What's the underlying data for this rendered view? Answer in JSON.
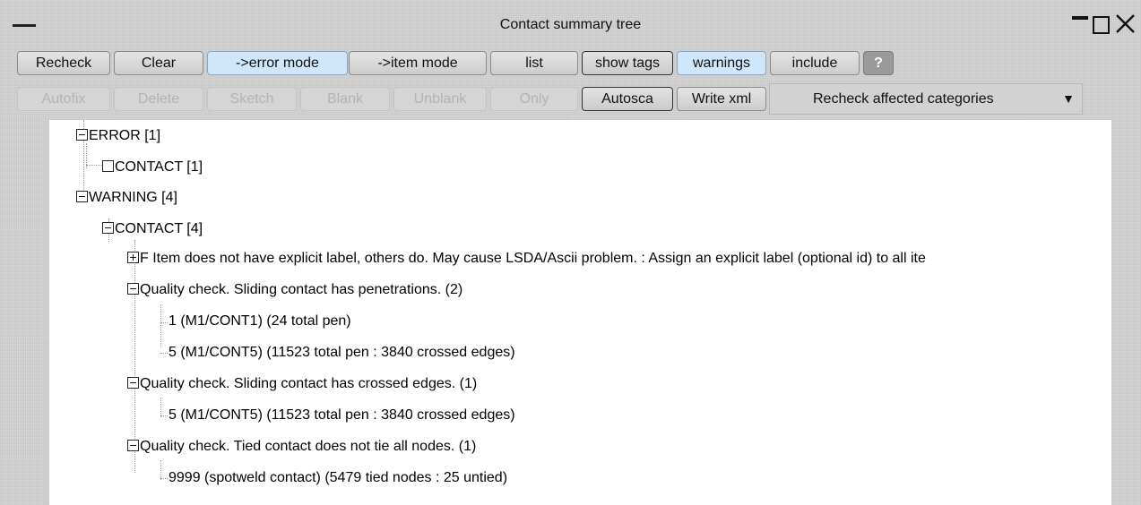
{
  "window": {
    "title": "Contact summary tree",
    "controls": [
      "minimize-icon",
      "maximize-icon",
      "close-icon"
    ]
  },
  "toolbar_row1": {
    "recheck": "Recheck",
    "clear": "Clear",
    "error_mode": "->error mode",
    "item_mode": "->item mode",
    "list": "list",
    "show_tags": "show tags",
    "warnings": "warnings",
    "include": "include",
    "help": "?"
  },
  "toolbar_row2": {
    "autofix": "Autofix",
    "delete": "Delete",
    "sketch": "Sketch",
    "blank": "Blank",
    "unblank": "Unblank",
    "only": "Only",
    "autosca": "Autosca",
    "write_xml": "Write xml",
    "recheck_dropdown": "Recheck affected categories"
  },
  "tree": {
    "error": "ERROR [1]",
    "error_contact": "CONTACT [1]",
    "warning": "WARNING [4]",
    "warning_contact": "CONTACT [4]",
    "label_issue": "F Item does not have explicit label, others do. May cause LSDA/Ascii problem. : Assign an explicit label (optional id) to all ite",
    "penetrations": "Quality check. Sliding contact has penetrations. (2)",
    "pen_item1": "1 (M1/CONT1) (24 total pen)",
    "pen_item2": "5 (M1/CONT5) (11523 total pen : 3840 crossed edges)",
    "crossed": "Quality check. Sliding contact has crossed edges. (1)",
    "crossed_item1": "5 (M1/CONT5) (11523 total pen : 3840 crossed edges)",
    "tied": "Quality check. Tied contact does not tie all nodes. (1)",
    "tied_item1": "9999 (spotweld contact) (5479 tied nodes : 25 untied)"
  }
}
